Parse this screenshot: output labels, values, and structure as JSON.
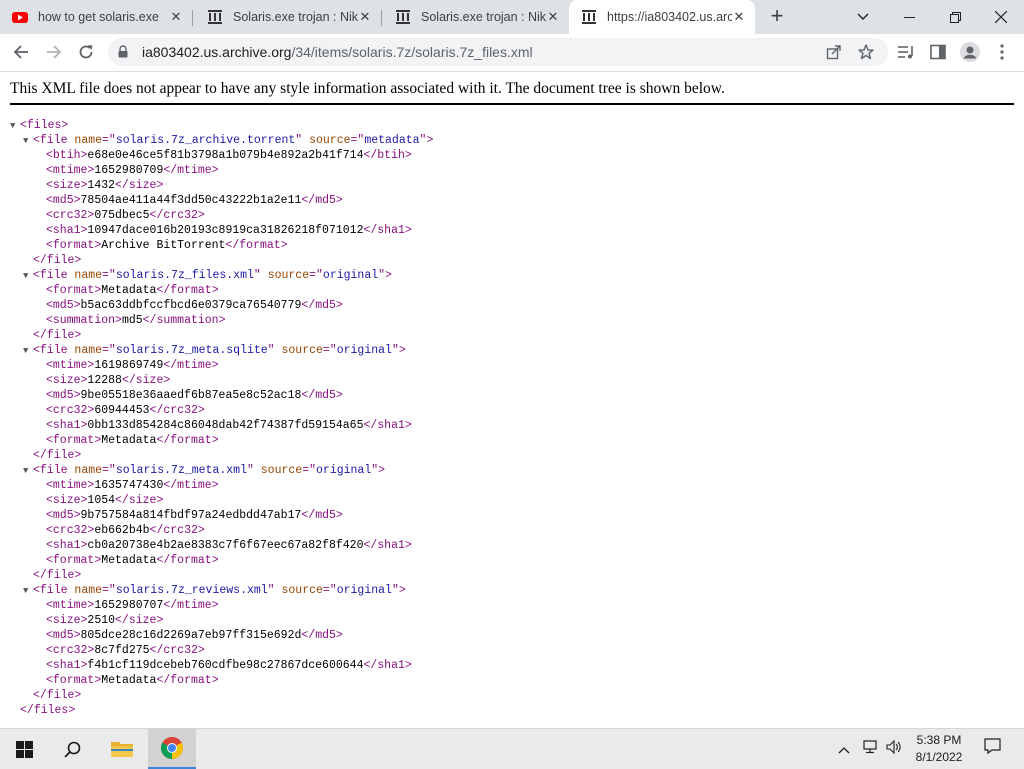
{
  "browser": {
    "tabs": [
      {
        "title": "how to get solaris.exe c",
        "favicon": "youtube-icon"
      },
      {
        "title": "Solaris.exe trojan : Niki",
        "favicon": "archive-icon"
      },
      {
        "title": "Solaris.exe trojan : Niki",
        "favicon": "archive-icon"
      },
      {
        "title": "https://ia803402.us.arc",
        "favicon": "archive-icon",
        "active": true
      }
    ],
    "url_host": "ia803402.us.archive.org",
    "url_path": "/34/items/solaris.7z/solaris.7z_files.xml",
    "accent": "#1a73e8"
  },
  "page": {
    "notice": "This XML file does not appear to have any style information associated with it. The document tree is shown below."
  },
  "xml": {
    "root": "files",
    "files": [
      {
        "name": "solaris.7z_archive.torrent",
        "source": "metadata",
        "children": [
          {
            "tag": "btih",
            "value": "e68e0e46ce5f81b3798a1b079b4e892a2b41f714"
          },
          {
            "tag": "mtime",
            "value": "1652980709"
          },
          {
            "tag": "size",
            "value": "1432"
          },
          {
            "tag": "md5",
            "value": "78504ae411a44f3dd50c43222b1a2e11"
          },
          {
            "tag": "crc32",
            "value": "075dbec5"
          },
          {
            "tag": "sha1",
            "value": "10947dace016b20193c8919ca31826218f071012"
          },
          {
            "tag": "format",
            "value": "Archive BitTorrent"
          }
        ]
      },
      {
        "name": "solaris.7z_files.xml",
        "source": "original",
        "children": [
          {
            "tag": "format",
            "value": "Metadata"
          },
          {
            "tag": "md5",
            "value": "b5ac63ddbfccfbcd6e0379ca76540779"
          },
          {
            "tag": "summation",
            "value": "md5"
          }
        ]
      },
      {
        "name": "solaris.7z_meta.sqlite",
        "source": "original",
        "children": [
          {
            "tag": "mtime",
            "value": "1619869749"
          },
          {
            "tag": "size",
            "value": "12288"
          },
          {
            "tag": "md5",
            "value": "9be05518e36aaedf6b87ea5e8c52ac18"
          },
          {
            "tag": "crc32",
            "value": "60944453"
          },
          {
            "tag": "sha1",
            "value": "0bb133d854284c86048dab42f74387fd59154a65"
          },
          {
            "tag": "format",
            "value": "Metadata"
          }
        ]
      },
      {
        "name": "solaris.7z_meta.xml",
        "source": "original",
        "children": [
          {
            "tag": "mtime",
            "value": "1635747430"
          },
          {
            "tag": "size",
            "value": "1054"
          },
          {
            "tag": "md5",
            "value": "9b757584a814fbdf97a24edbdd47ab17"
          },
          {
            "tag": "crc32",
            "value": "eb662b4b"
          },
          {
            "tag": "sha1",
            "value": "cb0a20738e4b2ae8383c7f6f67eec67a82f8f420"
          },
          {
            "tag": "format",
            "value": "Metadata"
          }
        ]
      },
      {
        "name": "solaris.7z_reviews.xml",
        "source": "original",
        "children": [
          {
            "tag": "mtime",
            "value": "1652980707"
          },
          {
            "tag": "size",
            "value": "2510"
          },
          {
            "tag": "md5",
            "value": "805dce28c16d2269a7eb97ff315e692d"
          },
          {
            "tag": "crc32",
            "value": "8c7fd275"
          },
          {
            "tag": "sha1",
            "value": "f4b1cf119dcebeb760cdfbe98c27867dce600644"
          },
          {
            "tag": "format",
            "value": "Metadata"
          }
        ]
      }
    ]
  },
  "taskbar": {
    "time": "5:38 PM",
    "date": "8/1/2022",
    "pinned": [
      "windows-start-icon",
      "search-icon",
      "file-explorer-icon",
      "chrome-icon"
    ]
  }
}
